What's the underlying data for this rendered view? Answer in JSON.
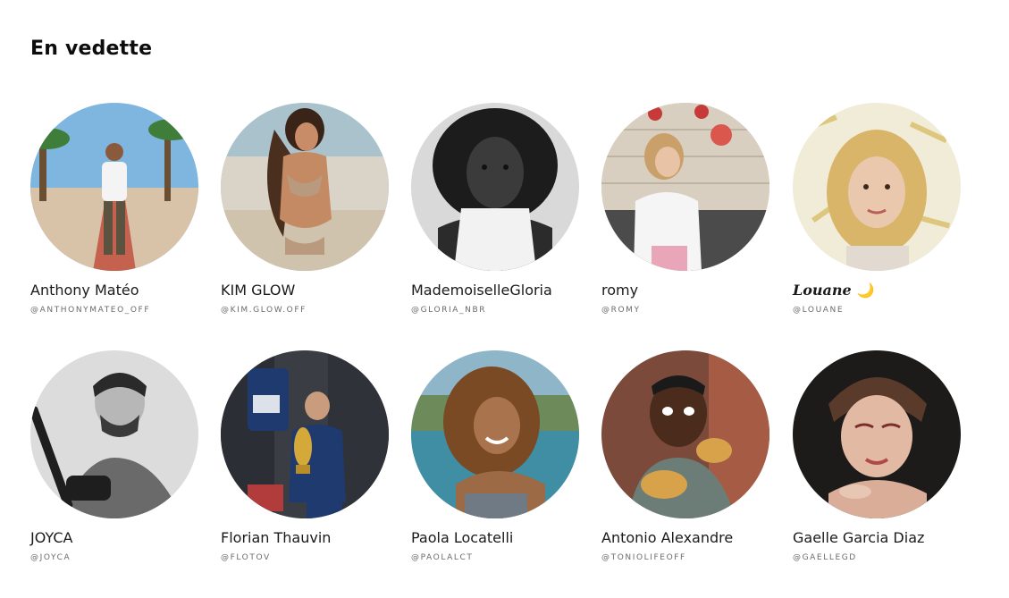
{
  "section": {
    "title": "En vedette"
  },
  "colors": {
    "text": "#1a1a1a",
    "handle": "#6b6b6b",
    "background": "#ffffff"
  },
  "profiles": [
    {
      "name": "Anthony Matéo",
      "handle": "@ANTHONYMATEO_OFF"
    },
    {
      "name": "KIM GLOW",
      "handle": "@KIM.GLOW.OFF"
    },
    {
      "name": "MademoiselleGloria",
      "handle": "@GLORIA_NBR"
    },
    {
      "name": "romy",
      "handle": "@ROMY"
    },
    {
      "name": "Louane",
      "emoji": "🌙",
      "handle": "@LOUANE"
    },
    {
      "name": "JOYCA",
      "handle": "@JOYCA"
    },
    {
      "name": "Florian Thauvin",
      "handle": "@FLOTOV"
    },
    {
      "name": "Paola Locatelli",
      "handle": "@PAOLALCT"
    },
    {
      "name": "Antonio Alexandre",
      "handle": "@TONIOLIFEOFF"
    },
    {
      "name": "Gaelle Garcia Diaz",
      "handle": "@GAELLEGD"
    }
  ],
  "avatar_icons": [
    "user-photo-icon"
  ]
}
